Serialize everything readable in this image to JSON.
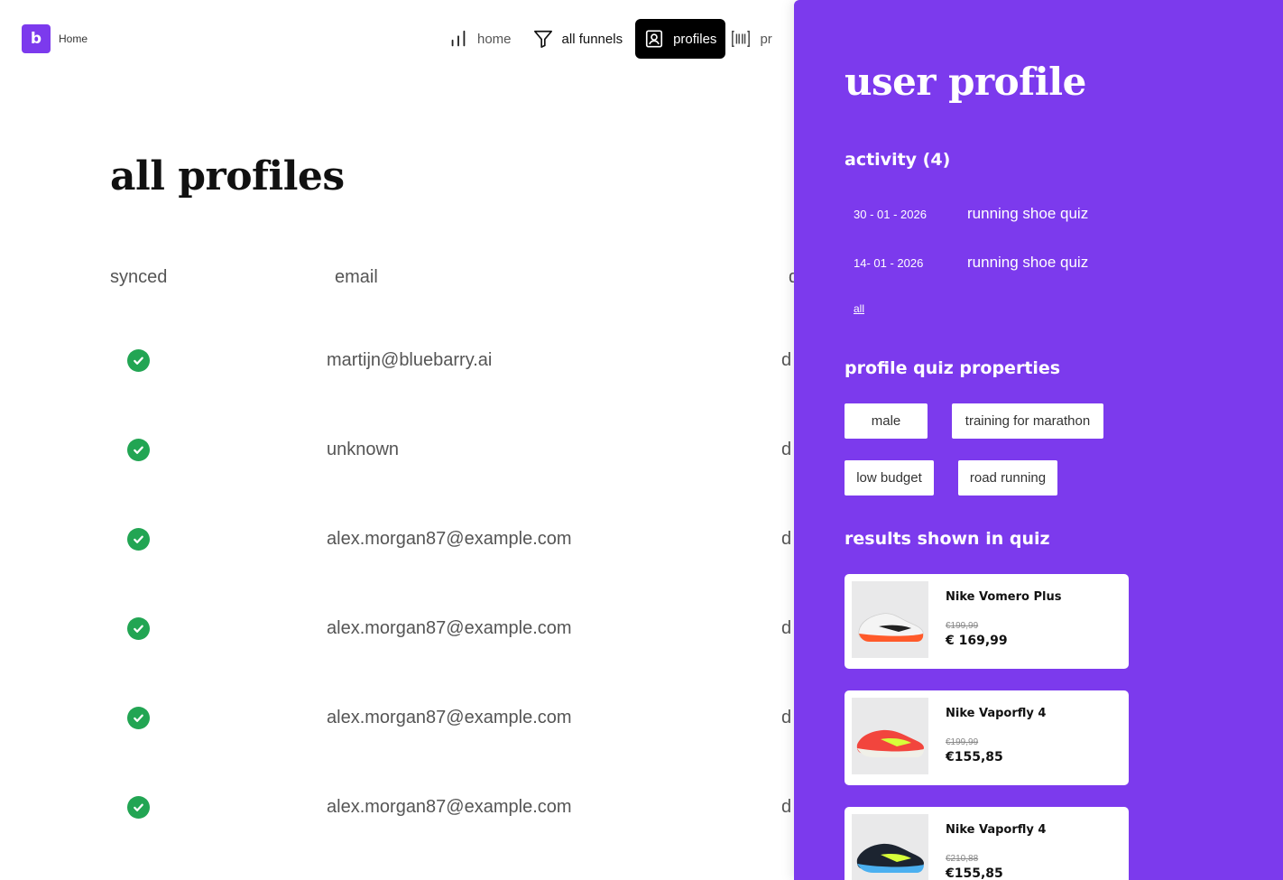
{
  "header": {
    "logo_letter": "b",
    "logo_label": "Home",
    "nav": [
      {
        "label": "home",
        "icon": "bar-chart-icon"
      },
      {
        "label": "all funnels",
        "icon": "funnel-icon"
      },
      {
        "label": "profiles",
        "icon": "profile-card-icon",
        "active": true
      },
      {
        "label": "pr",
        "icon": "barcode-scan-icon"
      }
    ]
  },
  "main": {
    "title": "all profiles",
    "columns": [
      "synced",
      "email",
      "d"
    ],
    "rows": [
      {
        "synced": true,
        "email": "martijn@bluebarry.ai",
        "third": "d"
      },
      {
        "synced": true,
        "email": "unknown",
        "third": "d"
      },
      {
        "synced": true,
        "email": "alex.morgan87@example.com",
        "third": "d"
      },
      {
        "synced": true,
        "email": "alex.morgan87@example.com",
        "third": "d"
      },
      {
        "synced": true,
        "email": "alex.morgan87@example.com",
        "third": "d"
      },
      {
        "synced": true,
        "email": "alex.morgan87@example.com",
        "third": "d"
      }
    ]
  },
  "panel": {
    "title": "user profile",
    "activity": {
      "heading": "activity (4)",
      "items": [
        {
          "date": "30 - 01 - 2026",
          "name": "running shoe quiz"
        },
        {
          "date": "14- 01 - 2026",
          "name": "running shoe quiz"
        }
      ],
      "all_link": "all"
    },
    "properties": {
      "heading": "profile quiz properties",
      "tags": [
        "male",
        "training for marathon",
        "low budget",
        "road running"
      ]
    },
    "results": {
      "heading": "results shown in quiz",
      "products": [
        {
          "name": "Nike Vomero Plus",
          "old_price": "€199,99",
          "price": "€ 169,99",
          "shoe_colors": {
            "upper": "#f4f4f4",
            "sole": "#ff5a2a",
            "accent": "#222222"
          }
        },
        {
          "name": "Nike Vaporfly 4",
          "old_price": "€199,99",
          "price": "€155,85",
          "shoe_colors": {
            "upper": "#f2453d",
            "sole": "#f0f0e8",
            "accent": "#d7ff3a"
          }
        },
        {
          "name": "Nike Vaporfly 4",
          "old_price": "€210,88",
          "price": "€155,85",
          "shoe_colors": {
            "upper": "#1c2430",
            "sole": "#4bb0f0",
            "accent": "#d7ff3a"
          }
        }
      ]
    }
  },
  "colors": {
    "brand": "#7c3aed",
    "success": "#22a553",
    "nav_active_bg": "#000000"
  }
}
